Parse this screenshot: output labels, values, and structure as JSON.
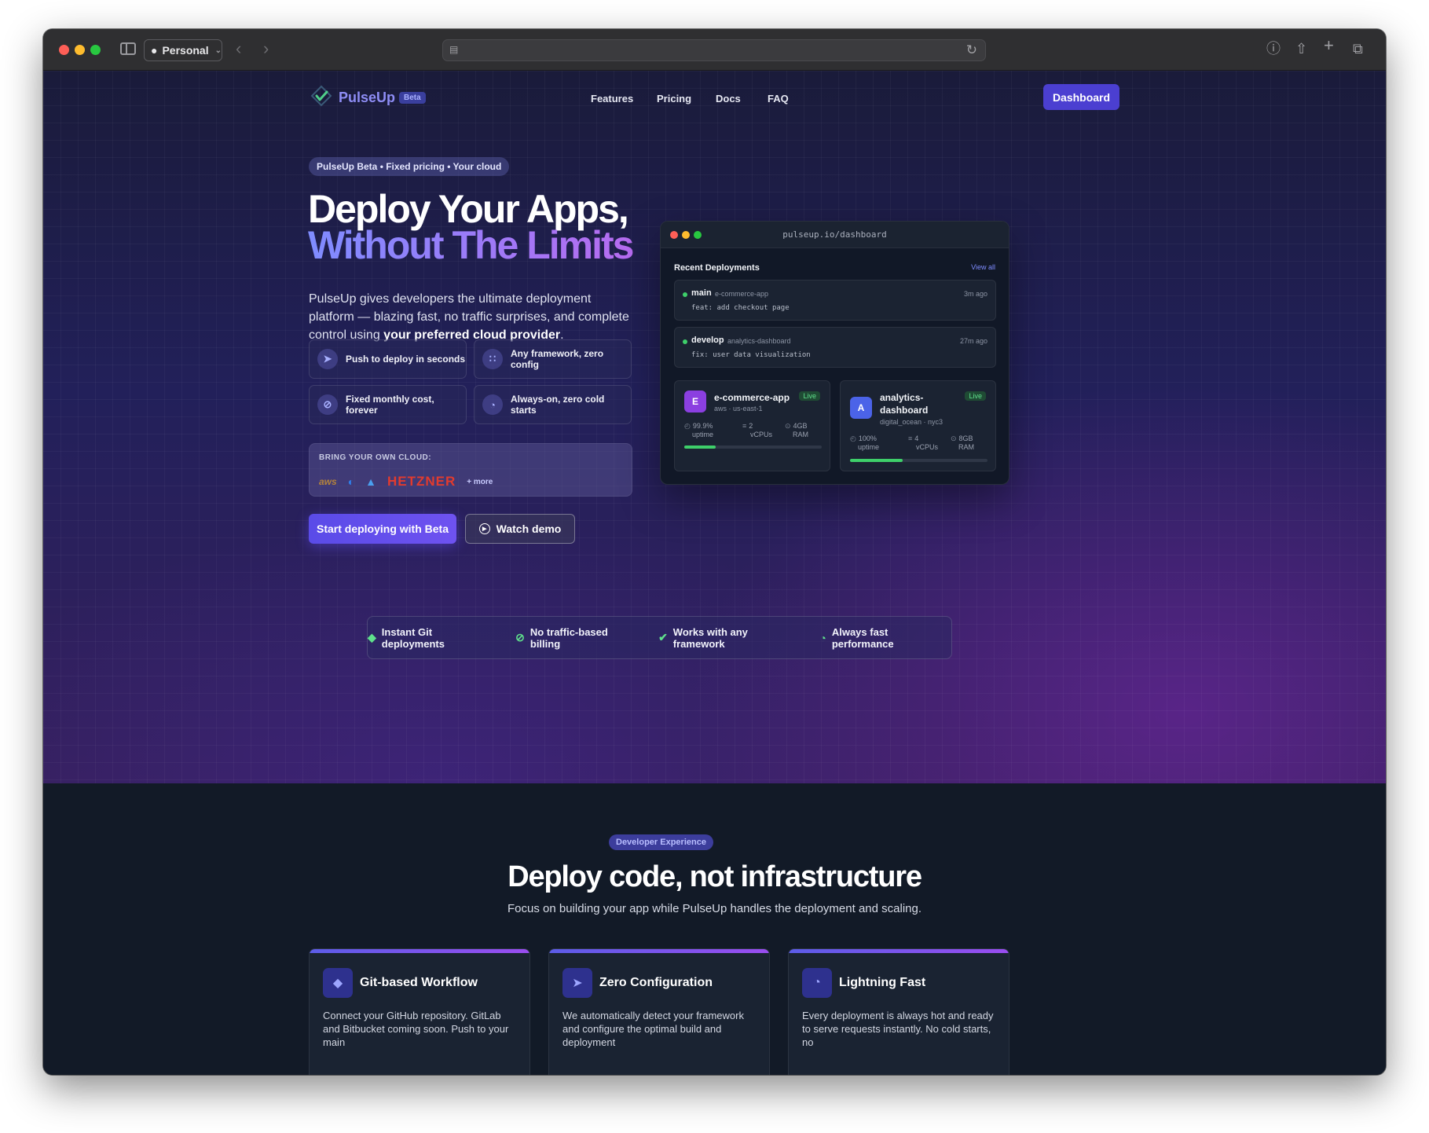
{
  "browser": {
    "profile": "Personal"
  },
  "nav": {
    "brand": "PulseUp",
    "badge": "Beta",
    "links": [
      "Features",
      "Pricing",
      "Docs",
      "FAQ"
    ],
    "dashboard_button": "Dashboard"
  },
  "hero": {
    "pill": "PulseUp Beta • Fixed pricing • Your cloud",
    "title_line1": "Deploy Your Apps,",
    "title_line2": "Without The Limits",
    "lead_prefix": "PulseUp gives developers the ultimate deployment platform — blazing fast, no traffic surprises, and complete control using ",
    "lead_strong": "your preferred cloud provider",
    "lead_suffix": ".",
    "features": [
      {
        "icon": "rocket-icon",
        "label": "Push to deploy in seconds"
      },
      {
        "icon": "grid-icon",
        "label": "Any framework, zero config"
      },
      {
        "icon": "no-dollar-icon",
        "label": "Fixed monthly cost, forever"
      },
      {
        "icon": "gauge-icon",
        "label": "Always-on, zero cold starts"
      }
    ],
    "cloud": {
      "label": "BRING YOUR OWN CLOUD:",
      "providers": [
        "aws",
        "digitalocean",
        "azure",
        "HETZNER"
      ],
      "more": "+ more"
    },
    "primary_cta": "Start deploying with Beta",
    "secondary_cta": "Watch demo"
  },
  "mock": {
    "url": "pulseup.io/dashboard",
    "title": "Recent Deployments",
    "view_all": "View all",
    "deployments": [
      {
        "branch": "main",
        "repo": "e-commerce-app",
        "ago": "3m ago",
        "message": "feat: add checkout page"
      },
      {
        "branch": "develop",
        "repo": "analytics-dashboard",
        "ago": "27m ago",
        "message": "fix: user data visualization"
      }
    ],
    "apps": [
      {
        "initial": "E",
        "name": "e-commerce-app",
        "status": "Live",
        "region": "aws · us-east-1",
        "uptime": "99.9%",
        "uptime_label": "uptime",
        "cpu": "2",
        "cpu_label": "vCPUs",
        "ram": "4GB",
        "ram_label": "RAM",
        "progress": 0.23,
        "color": "#8b3fe0"
      },
      {
        "initial": "A",
        "name_line1": "analytics-",
        "name_line2": "dashboard",
        "status": "Live",
        "region": "digital_ocean · nyc3",
        "uptime": "100%",
        "uptime_label": "uptime",
        "cpu": "4",
        "cpu_label": "vCPUs",
        "ram": "8GB",
        "ram_label": "RAM",
        "progress": 0.38,
        "color": "#4b63e8"
      }
    ]
  },
  "strip": [
    {
      "icon": "git-icon",
      "label": "Instant Git deployments"
    },
    {
      "icon": "no-dollar-icon",
      "label": "No traffic-based billing"
    },
    {
      "icon": "check-badge-icon",
      "label": "Works with any framework"
    },
    {
      "icon": "gauge-icon",
      "label": "Always fast performance"
    }
  ],
  "section": {
    "pill": "Developer Experience",
    "title": "Deploy code, not infrastructure",
    "subtitle": "Focus on building your app while PulseUp handles the deployment and scaling.",
    "cards": [
      {
        "icon": "git-icon",
        "title": "Git-based Workflow",
        "text": "Connect your GitHub repository. GitLab and Bitbucket coming soon. Push to your main"
      },
      {
        "icon": "rocket-icon",
        "title": "Zero Configuration",
        "text": "We automatically detect your framework and configure the optimal build and deployment"
      },
      {
        "icon": "gauge-icon",
        "title": "Lightning Fast",
        "text": "Every deployment is always hot and ready to serve requests instantly. No cold starts, no"
      }
    ]
  },
  "colors": {
    "accent": "#4b3fd1",
    "brand": "#8e8df5",
    "live": "#3ecf6a"
  }
}
